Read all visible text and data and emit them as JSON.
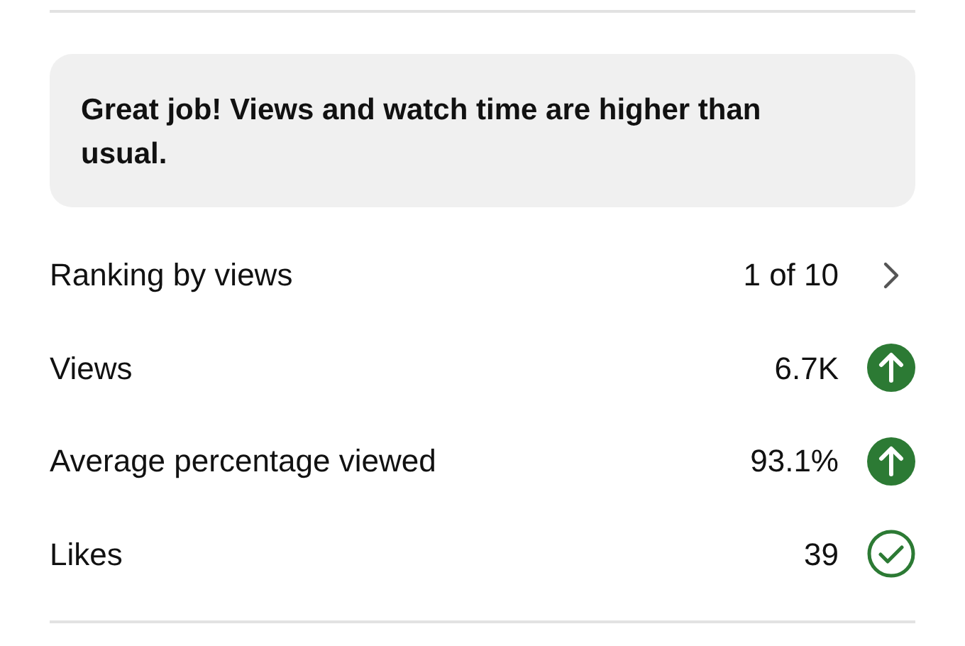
{
  "banner": {
    "text": "Great job! Views and watch time are higher than usual."
  },
  "metrics": [
    {
      "label": "Ranking by views",
      "value": "1 of 10",
      "kind": "link"
    },
    {
      "label": "Views",
      "value": "6.7K",
      "kind": "up"
    },
    {
      "label": "Average percentage viewed",
      "value": "93.1%",
      "kind": "up"
    },
    {
      "label": "Likes",
      "value": "39",
      "kind": "check"
    }
  ]
}
